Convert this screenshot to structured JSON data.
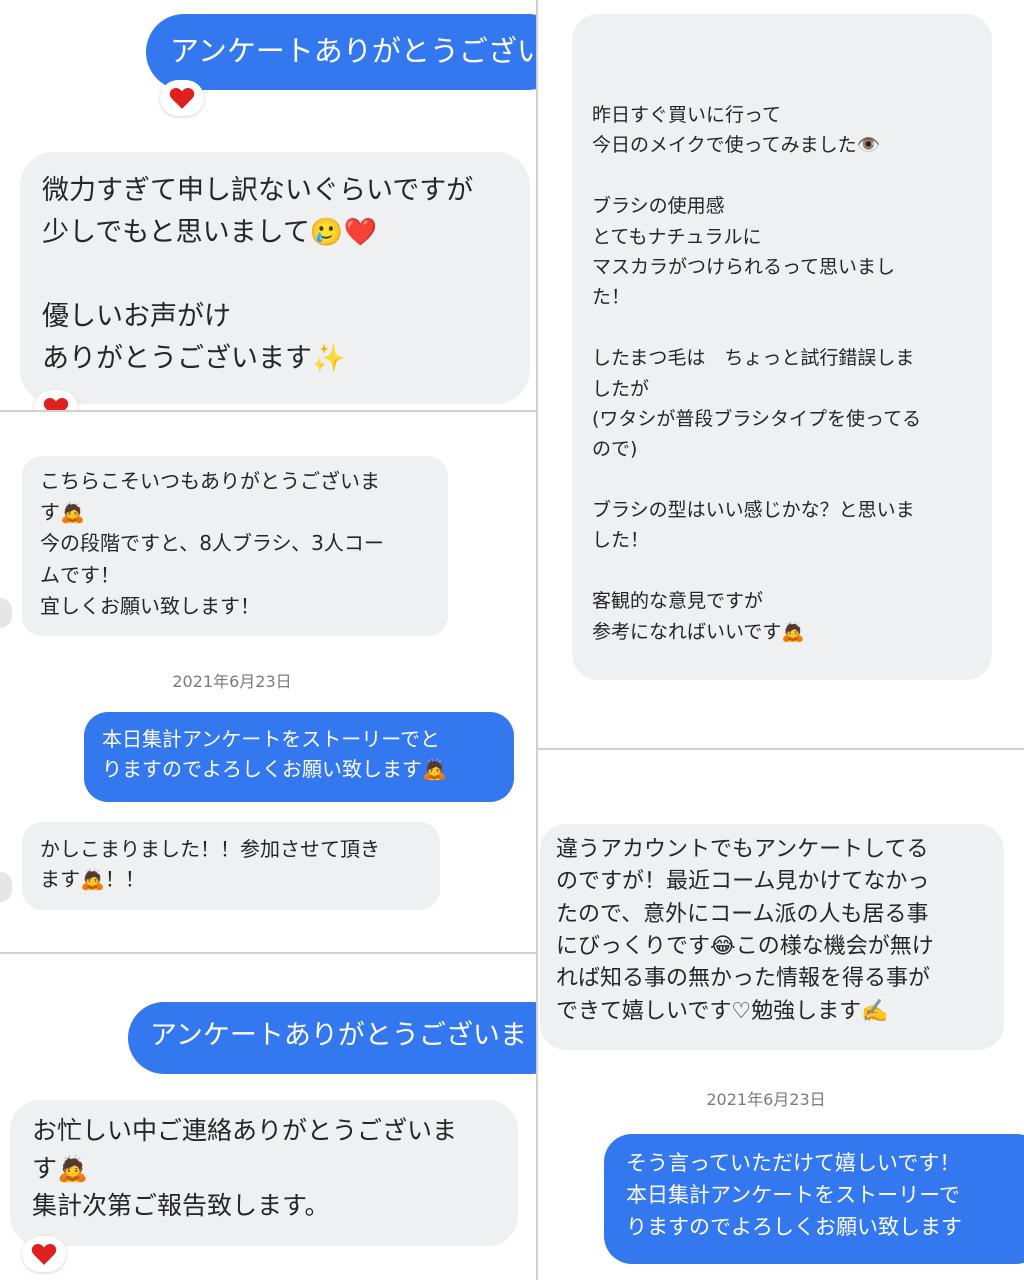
{
  "panels": {
    "p1": {
      "out_msg": "アンケートありがとうござい",
      "in_msg": "微力すぎて申し訳ないぐらいですが\n少しでもと思いまして🥲❤️\n\n優しいお声がけ\nありがとうございます✨"
    },
    "p2": {
      "in_msg": "こちらこそいつもありがとうございま\nす🙇\n今の段階ですと、8人ブラシ、3人コー\nムです！\n宜しくお願い致します！",
      "date": "2021年6月23日",
      "out_msg": "本日集計アンケートをストーリーでと\nりますのでよろしくお願い致します🙇",
      "in_msg2": "かしこまりました！！参加させて頂き\nます🙇！！"
    },
    "p3": {
      "out_msg": "アンケートありがとうございま",
      "in_msg": "お忙しい中ご連絡ありがとうございま\nす🙇\n集計次第ご報告致します。"
    },
    "p4": {
      "in_msg": "昨日すぐ買いに行って\n今日のメイクで使ってみました👁️\n\nブラシの使用感\nとてもナチュラルに\nマスカラがつけられるって思いまし\nた！\n\nしたまつ毛は　ちょっと試行錯誤しま\nしたが\n(ワタシが普段ブラシタイプを使ってる\nので)\n\nブラシの型はいい感じかな？と思いま\nした！\n\n客観的な意見ですが\n参考になればいいです🙇"
    },
    "p5": {
      "in_msg": "違うアカウントでもアンケートしてる\nのですが！最近コーム見かけてなかっ\nたので、意外にコーム派の人も居る事\nにびっくりです😂この様な機会が無け\nれば知る事の無かった情報を得る事が\nできて嬉しいです♡勉強します✍️",
      "date": "2021年6月23日",
      "out_msg": "そう言っていただけて嬉しいです！\n本日集計アンケートをストーリーで\nりますのでよろしくお願い致します"
    }
  },
  "colors": {
    "outgoing_bubble": "#3478f0",
    "incoming_bubble": "#eff0f2",
    "reaction_heart": "#e0201f"
  },
  "icons": {
    "reaction": "heart-reaction-icon"
  }
}
